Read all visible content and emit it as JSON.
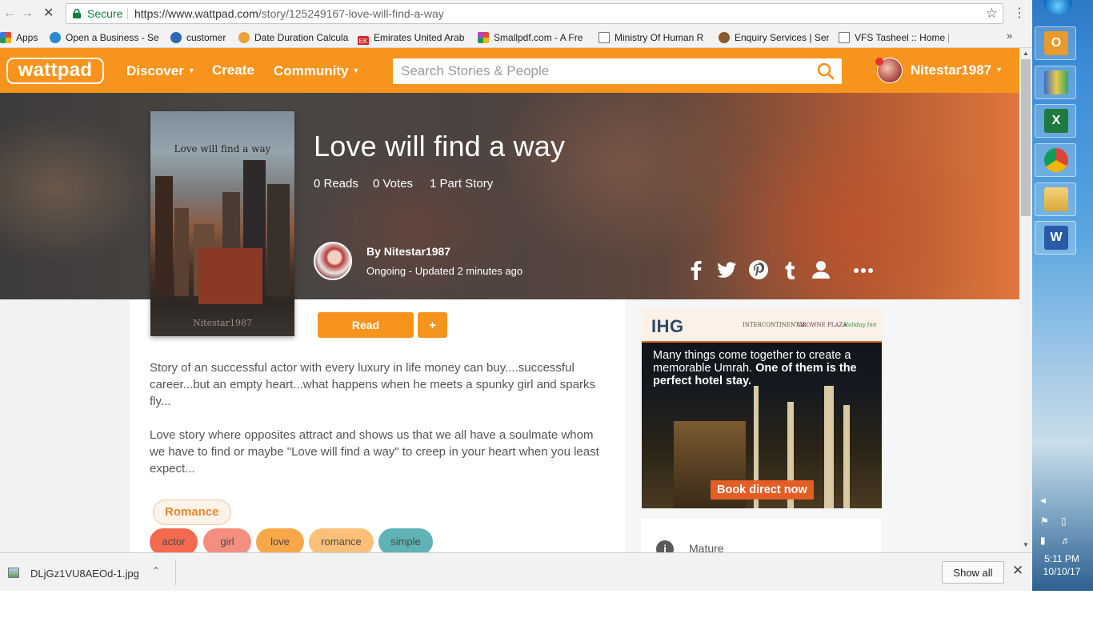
{
  "browser": {
    "secure_label": "Secure",
    "url_host": "https://www.wattpad.com",
    "url_path": "/story/125249167-love-will-find-a-way",
    "bookmarks": [
      {
        "label": "Apps",
        "color": "#e04a3a"
      },
      {
        "label": "Open a Business - Se",
        "color": "#2a8ad0"
      },
      {
        "label": "customer",
        "color": "#2a6ab0"
      },
      {
        "label": "Date Duration Calcula",
        "color": "#e7a33a"
      },
      {
        "label": "Emirates United Arab",
        "color": "#d02a2a"
      },
      {
        "label": "Smallpdf.com - A Fre",
        "color": "#c43ac8"
      },
      {
        "label": "Ministry Of Human R",
        "color": "#ffffff"
      },
      {
        "label": "Enquiry Services | Ser",
        "color": "#8a5a2a"
      },
      {
        "label": "VFS Tasheel :: Home |",
        "color": "#ffffff"
      }
    ],
    "more_label": "»"
  },
  "header": {
    "logo": "wattpad",
    "nav": {
      "discover": "Discover",
      "create": "Create",
      "community": "Community"
    },
    "search_placeholder": "Search Stories & People",
    "username": "Nitestar1987",
    "accent": "#f7941d"
  },
  "story": {
    "title": "Love will find a way",
    "cover_title": "Love will find a way",
    "cover_author": "Nitestar1987",
    "reads": "0 Reads",
    "votes": "0 Votes",
    "parts": "1 Part Story",
    "author_by": "By Nitestar1987",
    "status": "Ongoing - Updated 2 minutes ago",
    "share_icons": [
      "facebook-icon",
      "twitter-icon",
      "pinterest-icon",
      "tumblr-icon",
      "profile-icon",
      "more-icon"
    ],
    "read_label": "Read",
    "add_label": "+",
    "description_1": "Story of an successful actor with every luxury in life money can buy....successful career...but an empty heart...what happens when he meets a spunky girl and sparks fly...",
    "description_2": "Love story where opposites attract and shows us that we all have a soulmate whom we have to find or maybe \"Love will find a way\" to creep in your heart when you least expect...",
    "genre": "Romance",
    "tags": [
      {
        "label": "actor",
        "color": "#f46a4e"
      },
      {
        "label": "girl",
        "color": "#f48e7e"
      },
      {
        "label": "love",
        "color": "#f8a849"
      },
      {
        "label": "romance",
        "color": "#fbbf7a"
      },
      {
        "label": "simple",
        "color": "#5fb3b4"
      }
    ]
  },
  "ad": {
    "logo": "IHG",
    "brand_1": "INTERCONTINENTAL",
    "brand_2": "CROWNE PLAZA",
    "brand_3": "Holiday Inn",
    "text_plain": "Many things come together to create a memorable Umrah.",
    "text_bold": "One of them is the perfect hotel stay.",
    "cta": "Book direct now"
  },
  "info": {
    "mature_label": "Mature"
  },
  "download_bar": {
    "file_name": "DLjGz1VU8AEOd-1.jpg",
    "show_all": "Show all"
  },
  "taskbar": {
    "time": "5:11 PM",
    "date": "10/10/17"
  }
}
